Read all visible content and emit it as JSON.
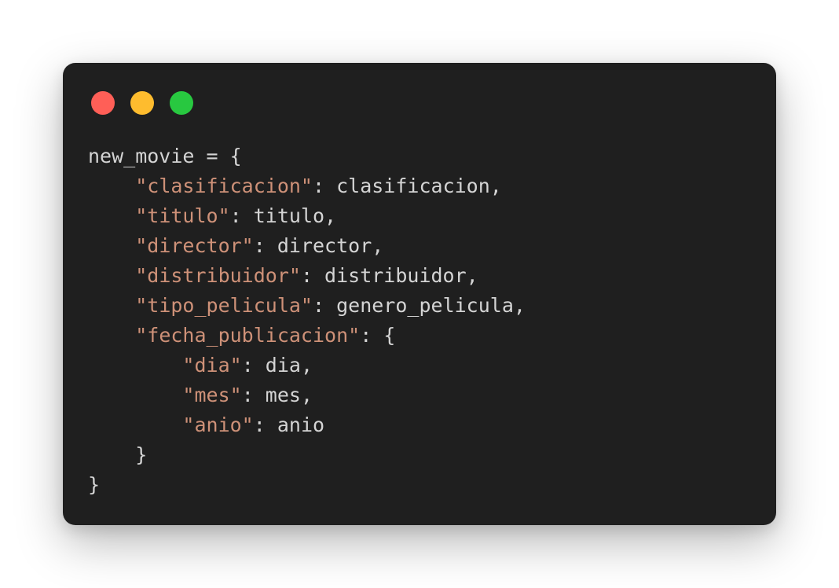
{
  "window": {
    "controls": [
      {
        "name": "close",
        "color": "#ff5f57"
      },
      {
        "name": "minimize",
        "color": "#febc2e"
      },
      {
        "name": "maximize",
        "color": "#28c840"
      }
    ]
  },
  "colors": {
    "background": "#1f1f1f",
    "text": "#d4d4d4",
    "string": "#ce9178"
  },
  "code": {
    "lines": [
      {
        "indent": "",
        "parts": [
          {
            "t": "plain",
            "v": "new_movie = {"
          }
        ]
      },
      {
        "indent": "    ",
        "parts": [
          {
            "t": "str",
            "v": "\"clasificacion\""
          },
          {
            "t": "plain",
            "v": ": clasificacion,"
          }
        ]
      },
      {
        "indent": "    ",
        "parts": [
          {
            "t": "str",
            "v": "\"titulo\""
          },
          {
            "t": "plain",
            "v": ": titulo,"
          }
        ]
      },
      {
        "indent": "    ",
        "parts": [
          {
            "t": "str",
            "v": "\"director\""
          },
          {
            "t": "plain",
            "v": ": director,"
          }
        ]
      },
      {
        "indent": "    ",
        "parts": [
          {
            "t": "str",
            "v": "\"distribuidor\""
          },
          {
            "t": "plain",
            "v": ": distribuidor,"
          }
        ]
      },
      {
        "indent": "    ",
        "parts": [
          {
            "t": "str",
            "v": "\"tipo_pelicula\""
          },
          {
            "t": "plain",
            "v": ": genero_pelicula,"
          }
        ]
      },
      {
        "indent": "    ",
        "parts": [
          {
            "t": "str",
            "v": "\"fecha_publicacion\""
          },
          {
            "t": "plain",
            "v": ": {"
          }
        ]
      },
      {
        "indent": "        ",
        "parts": [
          {
            "t": "str",
            "v": "\"dia\""
          },
          {
            "t": "plain",
            "v": ": dia,"
          }
        ]
      },
      {
        "indent": "        ",
        "parts": [
          {
            "t": "str",
            "v": "\"mes\""
          },
          {
            "t": "plain",
            "v": ": mes,"
          }
        ]
      },
      {
        "indent": "        ",
        "parts": [
          {
            "t": "str",
            "v": "\"anio\""
          },
          {
            "t": "plain",
            "v": ": anio"
          }
        ]
      },
      {
        "indent": "    ",
        "parts": [
          {
            "t": "plain",
            "v": "}"
          }
        ]
      },
      {
        "indent": "",
        "parts": [
          {
            "t": "plain",
            "v": "}"
          }
        ]
      }
    ]
  }
}
